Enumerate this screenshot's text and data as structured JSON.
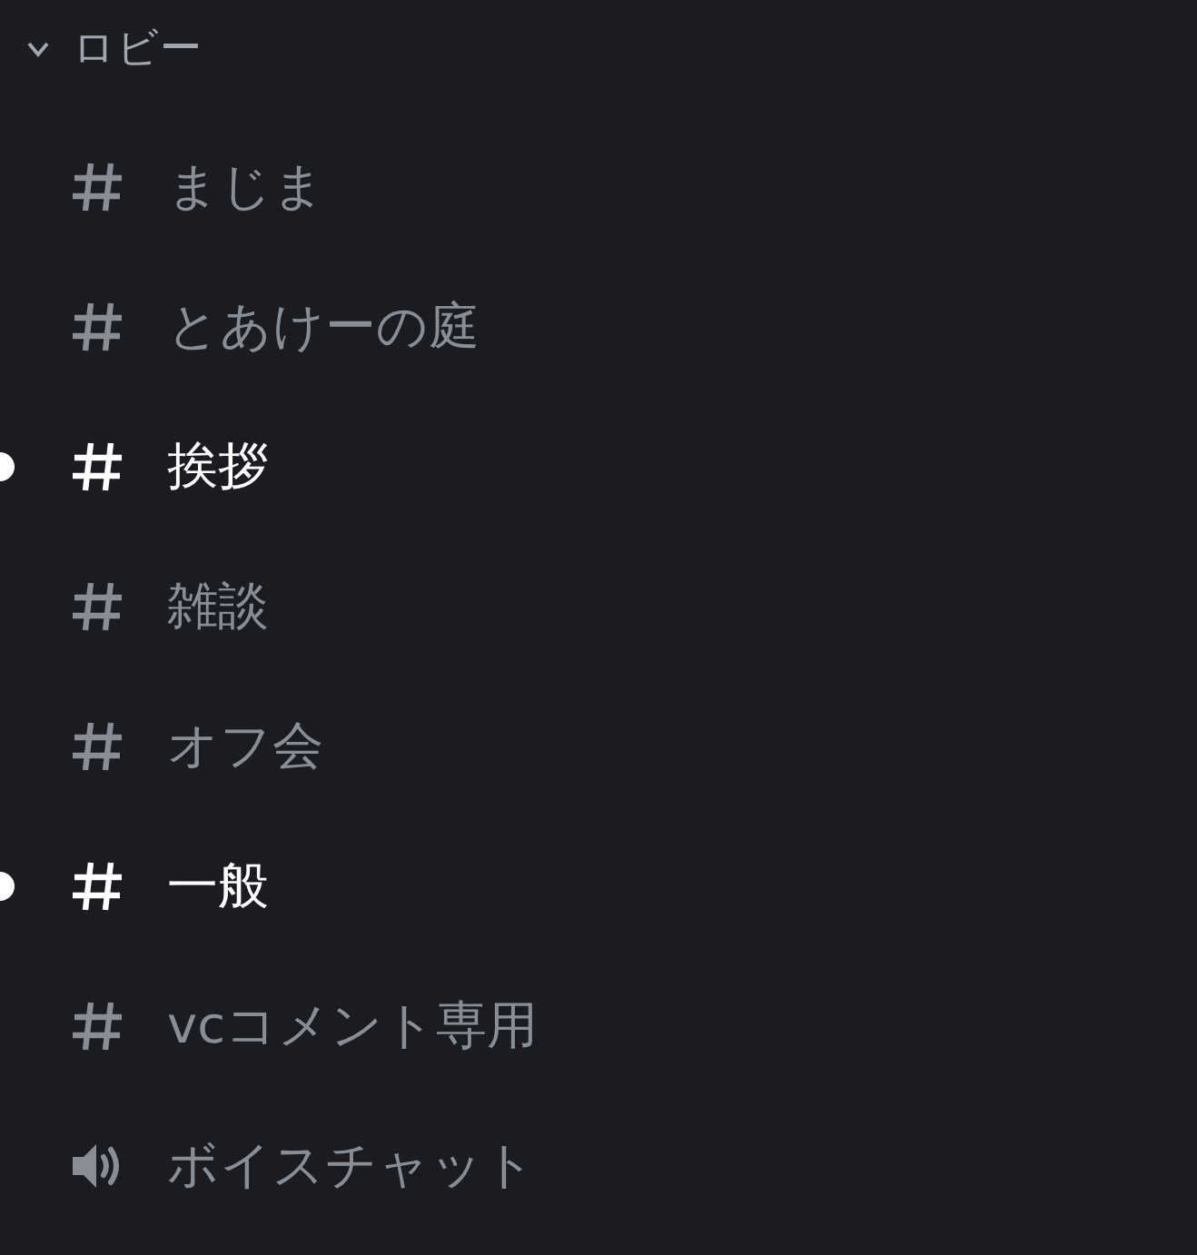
{
  "category": {
    "name": "ロビー",
    "expanded": true
  },
  "channels": [
    {
      "kind": "text",
      "name": "まじま",
      "unread": false
    },
    {
      "kind": "text",
      "name": "とあけーの庭",
      "unread": false
    },
    {
      "kind": "text",
      "name": "挨拶",
      "unread": true
    },
    {
      "kind": "text",
      "name": "雑談",
      "unread": false
    },
    {
      "kind": "text",
      "name": "オフ会",
      "unread": false
    },
    {
      "kind": "text",
      "name": "一般",
      "unread": true
    },
    {
      "kind": "text",
      "name": "vcコメント専用",
      "unread": false
    },
    {
      "kind": "voice",
      "name": "ボイスチャット",
      "unread": false
    }
  ]
}
